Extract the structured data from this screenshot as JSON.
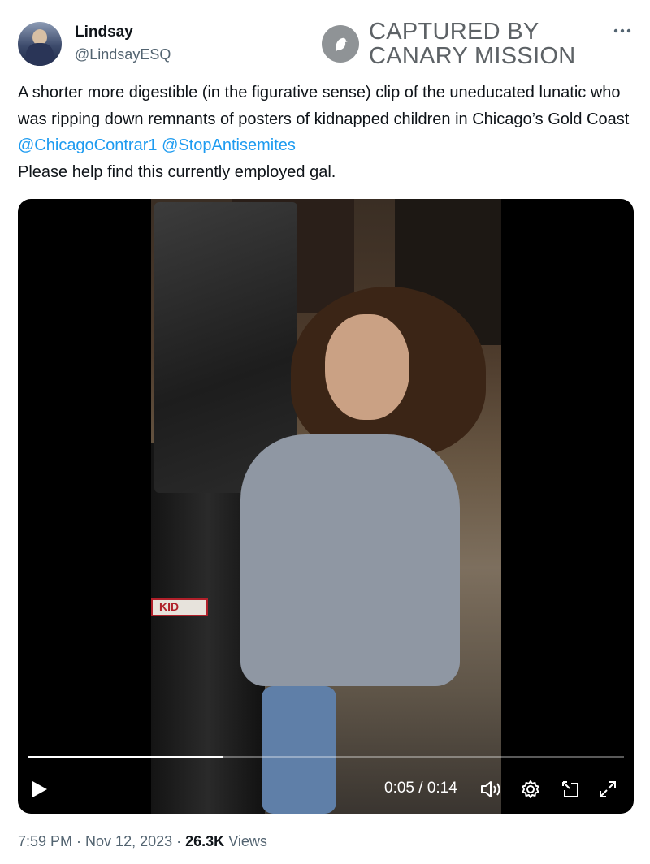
{
  "author": {
    "display_name": "Lindsay",
    "handle": "@LindsayESQ"
  },
  "watermark": {
    "line1": "CAPTURED BY",
    "line2": "CANARY MISSION"
  },
  "tweet": {
    "text_segments": [
      {
        "text": "A shorter more digestible (in the figurative sense) clip of the uneducated lunatic who was ripping down remnants of posters of kidnapped children in Chicago’s Gold Coast ",
        "type": "text"
      },
      {
        "text": "@ChicagoContrar1",
        "type": "mention"
      },
      {
        "text": " ",
        "type": "text"
      },
      {
        "text": "@StopAntisemites",
        "type": "mention"
      },
      {
        "text": "\nPlease help find this currently employed gal.",
        "type": "text"
      }
    ]
  },
  "video": {
    "current_time": "0:05",
    "duration": "0:14",
    "time_display": "0:05 / 0:14",
    "progress": 0.327,
    "sticker_text": "KID"
  },
  "meta": {
    "time": "7:59 PM",
    "date": "Nov 12, 2023",
    "separator": " · ",
    "views_count": "26.3K",
    "views_label": "Views"
  },
  "colors": {
    "mention": "#1d9bf0",
    "secondary_text": "#536471",
    "video_bg": "#000000"
  }
}
